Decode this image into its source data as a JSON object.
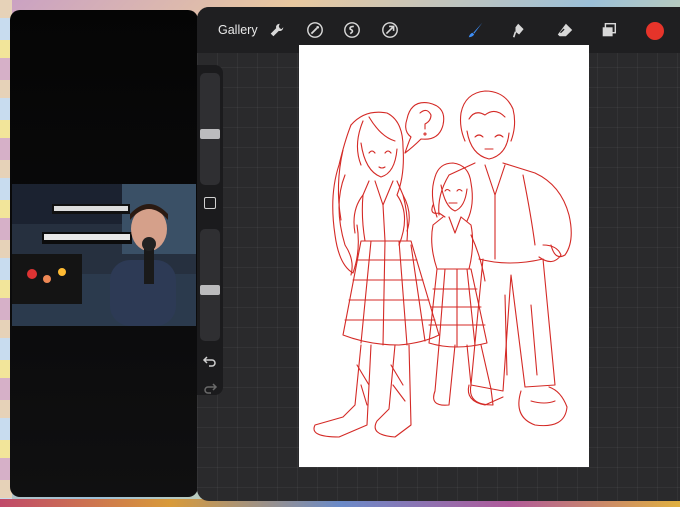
{
  "toolbar": {
    "gallery_label": "Gallery",
    "left_tools": [
      "wrench-icon",
      "magic-wand-icon",
      "selection-icon",
      "transform-icon"
    ],
    "right_tools": [
      "brush-icon",
      "smudge-icon",
      "eraser-icon",
      "layers-icon"
    ],
    "active_tool": "brush-icon",
    "active_color": "#e6342a"
  },
  "sidebar": {
    "brush_size_level": 0.45,
    "opacity_level": 0.45
  },
  "canvas": {
    "stroke_color": "#d42a26"
  }
}
